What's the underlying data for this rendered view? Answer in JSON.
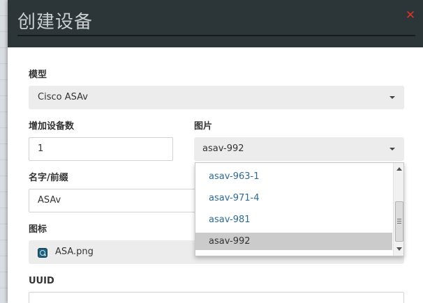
{
  "dialog": {
    "title": "创建设备",
    "close_symbol": "✕"
  },
  "model": {
    "label": "模型",
    "value": "Cisco ASAv"
  },
  "count": {
    "label": "增加设备数",
    "value": "1"
  },
  "image": {
    "label": "图片",
    "value": "asav-992",
    "options": [
      "asav-963-1",
      "asav-971-4",
      "asav-981",
      "asav-992"
    ],
    "selected": "asav-992"
  },
  "name_prefix": {
    "label": "名字/前缀",
    "value": "ASAv"
  },
  "icon": {
    "label": "图标",
    "value": "ASA.png",
    "icon_name": "router-icon"
  },
  "uuid": {
    "label": "UUID",
    "value": ""
  },
  "colors": {
    "header_bg": "#2c3538",
    "close": "#d9322b",
    "option_link": "#2d6a96",
    "option_selected_bg": "#cbcbcb"
  }
}
